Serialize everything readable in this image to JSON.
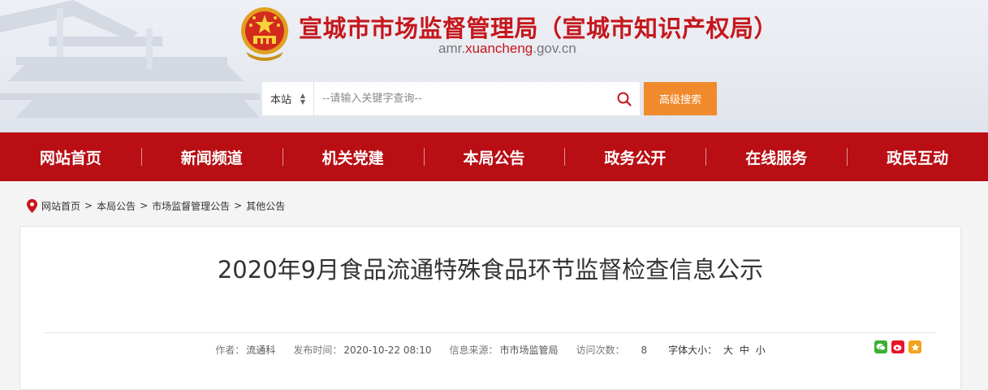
{
  "header": {
    "title": "宣城市市场监督管理局（宣城市知识产权局）",
    "domain_prefix": "amr.",
    "domain_highlight": "xuancheng",
    "domain_suffix": ".gov.cn"
  },
  "search": {
    "scope": "本站",
    "placeholder": "--请输入关键字查询--",
    "advanced_label": "高级搜索"
  },
  "nav": [
    {
      "label": "网站首页"
    },
    {
      "label": "新闻频道"
    },
    {
      "label": "机关党建"
    },
    {
      "label": "本局公告"
    },
    {
      "label": "政务公开"
    },
    {
      "label": "在线服务"
    },
    {
      "label": "政民互动"
    }
  ],
  "breadcrumb": [
    "网站首页",
    "本局公告",
    "市场监督管理公告",
    "其他公告"
  ],
  "breadcrumb_sep": ">",
  "article": {
    "title": "2020年9月食品流通特殊食品环节监督检查信息公示",
    "author_label": "作者：",
    "author": "流通科",
    "date_label": "发布时间：",
    "date": "2020-10-22 08:10",
    "source_label": "信息来源：",
    "source": "市市场监管局",
    "views_label": "访问次数：",
    "views": "8",
    "font_label": "字体大小：",
    "font_large": "大",
    "font_medium": "中",
    "font_small": "小"
  },
  "colors": {
    "brand_red": "#c5171c",
    "nav_red": "#b80e14",
    "accent_orange": "#f08a2c"
  },
  "icons": [
    "national-emblem-icon",
    "search-icon",
    "location-pin-icon",
    "wechat-icon",
    "weibo-icon",
    "favorite-icon"
  ]
}
